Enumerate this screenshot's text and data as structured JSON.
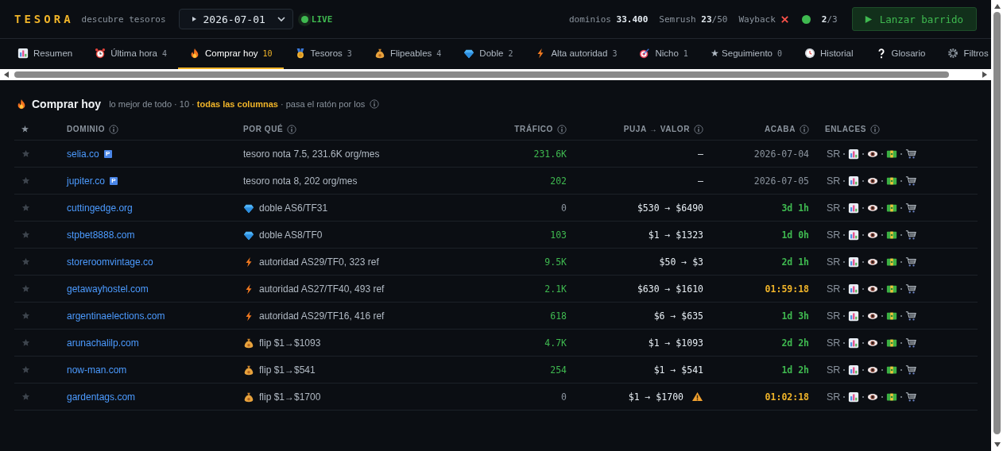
{
  "header": {
    "logo": "TESORA",
    "tagline": "descubre tesoros",
    "date": "2026-07-01",
    "live": {
      "label": "LIVE",
      "on": true
    },
    "domains": "dominios **33.400**",
    "semrush": "Semrush **23**/50",
    "wayback": {
      "label": "Wayback",
      "ok": false
    },
    "workers": {
      "text": "**2**/3",
      "online": true
    },
    "button": "Lanzar barrido"
  },
  "tabs": [
    {
      "label": "Resumen",
      "selected": false
    },
    {
      "label": "Última hora",
      "count": "4",
      "selected": false
    },
    {
      "label": "Comprar hoy",
      "count": "10",
      "selected": true
    },
    {
      "label": "Tesoros",
      "count": "3",
      "selected": false
    },
    {
      "label": "Flipeables",
      "count": "4",
      "selected": false
    },
    {
      "label": "Doble",
      "count": "2",
      "selected": false
    },
    {
      "label": "Alta autoridad",
      "count": "3",
      "selected": false
    },
    {
      "label": "Nicho",
      "count": "1",
      "selected": false
    },
    {
      "label": "★ Seguimiento",
      "count": "0",
      "selected": false
    },
    {
      "label": "Historial",
      "selected": false
    },
    {
      "label": "Glosario",
      "selected": false
    },
    {
      "label": "Filtros",
      "selected": false
    }
  ],
  "section": {
    "title": "Comprar hoy",
    "subtitle": "lo mejor de todo · 10 · **todas las columnas** · pasa el ratón por los"
  },
  "table": {
    "columns": [
      "★",
      "DOMINIO",
      "POR QUÉ",
      "TRÁFICO",
      "PUJA → VALOR",
      "ACABA",
      "ENLACES"
    ],
    "rows": [
      {
        "starred": false,
        "domain": "selia.co",
        "badge": "P",
        "reason": {
          "kind": "tesoro",
          "text": "tesoro nota 7.5, 231.6K org/mes"
        },
        "traffic": "231.6K",
        "traffic_zero": false,
        "bid": "—",
        "warning": false,
        "ends": {
          "kind": "date",
          "text": "2026-07-04"
        },
        "links": "SR"
      },
      {
        "starred": false,
        "domain": "jupiter.co",
        "badge": "P",
        "reason": {
          "kind": "tesoro",
          "text": "tesoro nota 8, 202 org/mes"
        },
        "traffic": "202",
        "traffic_zero": false,
        "bid": "—",
        "warning": false,
        "ends": {
          "kind": "date",
          "text": "2026-07-05"
        },
        "links": "SR"
      },
      {
        "starred": false,
        "domain": "cuttingedge.org",
        "reason": {
          "kind": "doble",
          "text": "doble AS6/TF31"
        },
        "traffic": "0",
        "traffic_zero": true,
        "bid": "$530 → $6490",
        "warning": false,
        "ends": {
          "kind": "days",
          "text": "3d 1h"
        },
        "links": "SR"
      },
      {
        "starred": false,
        "domain": "stpbet8888.com",
        "reason": {
          "kind": "doble",
          "text": "doble AS8/TF0"
        },
        "traffic": "103",
        "traffic_zero": false,
        "bid": "$1 → $1323",
        "warning": false,
        "ends": {
          "kind": "days",
          "text": "1d 0h"
        },
        "links": "SR"
      },
      {
        "starred": false,
        "domain": "storeroomvintage.co",
        "reason": {
          "kind": "autoridad",
          "text": "autoridad AS29/TF0, 323 ref"
        },
        "traffic": "9.5K",
        "traffic_zero": false,
        "bid": "$50 → $3",
        "warning": false,
        "ends": {
          "kind": "days",
          "text": "2d 1h"
        },
        "links": "SR"
      },
      {
        "starred": false,
        "domain": "getawayhostel.com",
        "reason": {
          "kind": "autoridad",
          "text": "autoridad AS27/TF40, 493 ref"
        },
        "traffic": "2.1K",
        "traffic_zero": false,
        "bid": "$630 → $1610",
        "warning": false,
        "ends": {
          "kind": "countdown",
          "text": "01:59:18"
        },
        "links": "SR"
      },
      {
        "starred": false,
        "domain": "argentinaelections.com",
        "reason": {
          "kind": "autoridad",
          "text": "autoridad AS29/TF16, 416 ref"
        },
        "traffic": "618",
        "traffic_zero": false,
        "bid": "$6 → $635",
        "warning": false,
        "ends": {
          "kind": "days",
          "text": "1d 3h"
        },
        "links": "SR"
      },
      {
        "starred": false,
        "domain": "arunachalilp.com",
        "reason": {
          "kind": "flip",
          "text": "flip $1→$1093"
        },
        "traffic": "4.7K",
        "traffic_zero": false,
        "bid": "$1 → $1093",
        "warning": false,
        "ends": {
          "kind": "days",
          "text": "2d 2h"
        },
        "links": "SR"
      },
      {
        "starred": false,
        "domain": "now-man.com",
        "reason": {
          "kind": "flip",
          "text": "flip $1→$541"
        },
        "traffic": "254",
        "traffic_zero": false,
        "bid": "$1 → $541",
        "warning": false,
        "ends": {
          "kind": "days",
          "text": "1d 2h"
        },
        "links": "SR"
      },
      {
        "starred": false,
        "domain": "gardentags.com",
        "reason": {
          "kind": "flip",
          "text": "flip $1→$1700"
        },
        "traffic": "0",
        "traffic_zero": true,
        "bid": "$1 → $1700",
        "warning": true,
        "ends": {
          "kind": "countdown",
          "text": "01:02:18"
        },
        "links": "SR"
      }
    ]
  }
}
